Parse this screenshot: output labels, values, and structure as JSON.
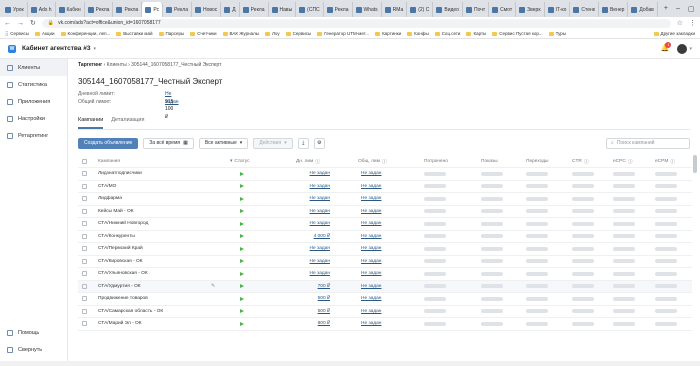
{
  "browser": {
    "tabs": [
      {
        "label": "Урок"
      },
      {
        "label": "Ads h"
      },
      {
        "label": "Кабин"
      },
      {
        "label": "Рекла"
      },
      {
        "label": "Рекла"
      },
      {
        "label": "Рс",
        "active": true
      },
      {
        "label": "Рекла"
      },
      {
        "label": "Новос"
      },
      {
        "label": "Д"
      },
      {
        "label": "Рекла"
      },
      {
        "label": "Навы"
      },
      {
        "label": "(СПС"
      },
      {
        "label": "Рекла"
      },
      {
        "label": "Whats"
      },
      {
        "label": "RMa"
      },
      {
        "label": "(2) С"
      },
      {
        "label": "Видео"
      },
      {
        "label": "Почт"
      },
      {
        "label": "Смот"
      },
      {
        "label": "Зверк"
      },
      {
        "label": "IT-ко"
      },
      {
        "label": "Стенк"
      },
      {
        "label": "Венер"
      },
      {
        "label": "Добав"
      }
    ],
    "url": "vk.com/ads?act=office&union_id=1607058177",
    "bookmarks": [
      {
        "label": "Сервисы",
        "icon": "apps-icon"
      },
      {
        "label": "Акции",
        "icon": "folder-icon"
      },
      {
        "label": "Конференции, леп...",
        "icon": "folder-icon"
      },
      {
        "label": "Выставки май",
        "icon": "folder-icon"
      },
      {
        "label": "Парсеры",
        "icon": "folder-icon"
      },
      {
        "label": "Счетчики",
        "icon": "folder-icon"
      },
      {
        "label": "ВАК Журналы",
        "icon": "folder-icon"
      },
      {
        "label": "Лоу",
        "icon": "folder-icon"
      },
      {
        "label": "Сервисы",
        "icon": "folder-icon"
      },
      {
        "label": "Генератор UTM-мет...",
        "icon": "folder-icon"
      },
      {
        "label": "Картинки",
        "icon": "folder-icon"
      },
      {
        "label": "Конфы",
        "icon": "folder-icon"
      },
      {
        "label": "Соц.сети",
        "icon": "folder-icon"
      },
      {
        "label": "Карты",
        "icon": "folder-icon"
      },
      {
        "label": "Сервис Пустая кор...",
        "icon": "folder-icon"
      },
      {
        "label": "Туры",
        "icon": "folder-icon"
      }
    ],
    "bookmarks_other": "Другие закладки"
  },
  "header": {
    "title": "Кабинет агентства #3",
    "notification_count": "1"
  },
  "sidebar": {
    "items": [
      {
        "label": "Клиенты",
        "icon": "clients-icon",
        "active": true
      },
      {
        "label": "Статистика",
        "icon": "stats-icon"
      },
      {
        "label": "Приложения",
        "icon": "apps-icon"
      },
      {
        "label": "Настройки",
        "icon": "settings-icon"
      },
      {
        "label": "Ретаргетинг",
        "icon": "retarget-icon"
      }
    ],
    "bottom": [
      {
        "label": "Помощь",
        "icon": "help-icon"
      },
      {
        "label": "Свернуть",
        "icon": "collapse-icon"
      }
    ]
  },
  "breadcrumbs": {
    "root": "Таргетинг",
    "level1": "Клиенты",
    "level2": "305144_1607058177_Честный Эксперт"
  },
  "client": {
    "title": "305144_1607058177_Честный Эксперт",
    "daily_limit_label": "Дневной лимит:",
    "daily_limit_value": "Не задан",
    "total_limit_label": "Общий лимит:",
    "total_limit_value": "915 100 ₽"
  },
  "tabs": {
    "campaigns": "Кампании",
    "details": "Детализация"
  },
  "toolbar": {
    "create": "Создать объявление",
    "period": "За всё время",
    "filter": "Все активные",
    "actions": "Действия",
    "search_placeholder": "Поиск кампаний"
  },
  "table": {
    "columns": {
      "campaign": "Кампания",
      "status": "Статус",
      "day_limit": "Дн. лим",
      "total_limit": "Общ. лим",
      "spent": "Потрачено",
      "views": "Показы",
      "clicks": "Переходы",
      "ctr": "CTR",
      "ecpc": "eCPC",
      "ecpm": "eCPM"
    },
    "rows": [
      {
        "name": "Лидзнатподписчики",
        "day": "Не задан",
        "total": "Не задан"
      },
      {
        "name": "СТА/МО",
        "day": "Не задан",
        "total": "Не задан"
      },
      {
        "name": "Лидфарма",
        "day": "Не задан",
        "total": "Не задан"
      },
      {
        "name": "Кейсы Май - ОК",
        "day": "Не задан",
        "total": "Не задан"
      },
      {
        "name": "СТА/Нижний Новгород",
        "day": "Не задан",
        "total": "Не задан"
      },
      {
        "name": "СТА/Конкуренты",
        "day": "4 000 ₽",
        "total": "Не задан"
      },
      {
        "name": "СТА/Пермский Край",
        "day": "Не задан",
        "total": "Не задан"
      },
      {
        "name": "СТА/Кировская - ОК",
        "day": "Не задан",
        "total": "Не задан"
      },
      {
        "name": "СТА/Ульяновская - ОК",
        "day": "Не задан",
        "total": "Не задан"
      },
      {
        "name": "СТА/Удмуртия - ОК",
        "day": "700 ₽",
        "total": "Не задан"
      },
      {
        "name": "Продвижение товаров",
        "day": "500 ₽",
        "total": "Не задан"
      },
      {
        "name": "СТА/Самарская область - ОК",
        "day": "500 ₽",
        "total": "Не задан"
      },
      {
        "name": "СТА/Марий Эл - ОК",
        "day": "800 ₽",
        "total": "Не задан"
      }
    ]
  }
}
